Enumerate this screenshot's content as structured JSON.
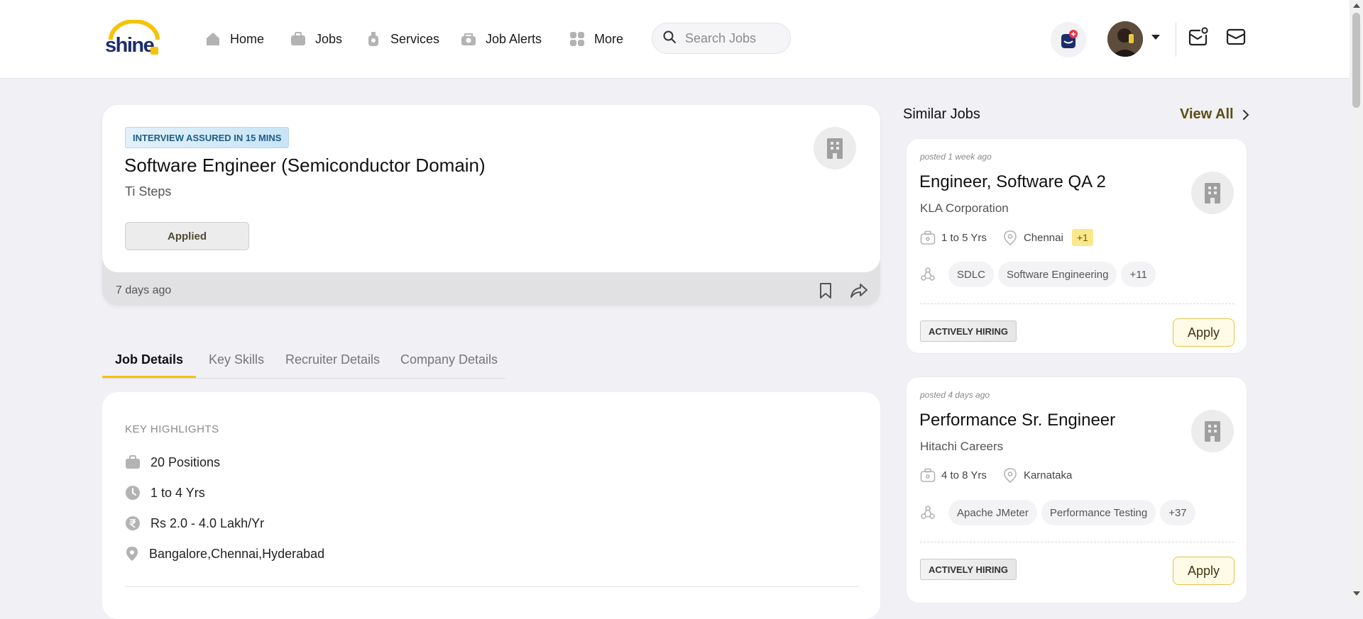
{
  "header": {
    "logo_text": "shine",
    "nav": [
      {
        "label": "Home",
        "icon": "home-icon"
      },
      {
        "label": "Jobs",
        "icon": "briefcase-icon"
      },
      {
        "label": "Services",
        "icon": "services-icon"
      },
      {
        "label": "Job Alerts",
        "icon": "job-alerts-icon"
      },
      {
        "label": "More",
        "icon": "grid-icon"
      }
    ],
    "search_placeholder": "Search Jobs"
  },
  "job": {
    "badge": "INTERVIEW ASSURED IN 15 MINS",
    "title": "Software Engineer (Semiconductor Domain)",
    "company": "Ti Steps",
    "status_button": "Applied",
    "posted": "7 days ago"
  },
  "tabs": [
    "Job Details",
    "Key Skills",
    "Recruiter Details",
    "Company Details"
  ],
  "highlights": {
    "heading": "KEY HIGHLIGHTS",
    "positions": "20 Positions",
    "experience": "1 to 4 Yrs",
    "salary": "Rs 2.0 - 4.0 Lakh/Yr",
    "locations": "Bangalore,Chennai,Hyderabad"
  },
  "similar": {
    "title": "Similar Jobs",
    "view_all": "View All",
    "jobs": [
      {
        "posted": "posted 1 week ago",
        "title": "Engineer, Software QA 2",
        "company": "KLA Corporation",
        "experience": "1 to 5 Yrs",
        "location": "Chennai",
        "location_more": "+1",
        "skills": [
          "SDLC",
          "Software Engineering",
          "+11"
        ],
        "badge": "ACTIVELY HIRING",
        "apply": "Apply"
      },
      {
        "posted": "posted 4 days ago",
        "title": "Performance Sr. Engineer",
        "company": "Hitachi Careers",
        "experience": "4 to 8 Yrs",
        "location": "Karnataka",
        "location_more": "",
        "skills": [
          "Apache JMeter",
          "Performance Testing",
          "+37"
        ],
        "badge": "ACTIVELY HIRING",
        "apply": "Apply"
      }
    ]
  },
  "colors": {
    "accent_yellow": "#f5c30a",
    "brand_navy": "#1c2d6b",
    "page_bg": "#f0f0f5"
  }
}
